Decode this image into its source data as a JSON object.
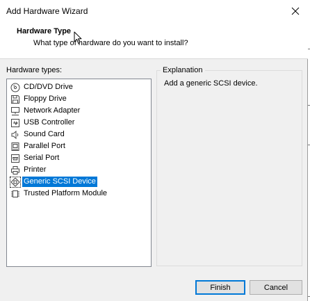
{
  "window": {
    "title": "Add Hardware Wizard"
  },
  "header": {
    "title": "Hardware Type",
    "subtitle": "What type of hardware do you want to install?"
  },
  "hardware_list": {
    "label": "Hardware types:",
    "selected_index": 7,
    "items": [
      {
        "label": "CD/DVD Drive",
        "icon": "cd-dvd-icon"
      },
      {
        "label": "Floppy Drive",
        "icon": "floppy-drive-icon"
      },
      {
        "label": "Network Adapter",
        "icon": "network-adapter-icon"
      },
      {
        "label": "USB Controller",
        "icon": "usb-controller-icon"
      },
      {
        "label": "Sound Card",
        "icon": "sound-card-icon"
      },
      {
        "label": "Parallel Port",
        "icon": "parallel-port-icon"
      },
      {
        "label": "Serial Port",
        "icon": "serial-port-icon"
      },
      {
        "label": "Printer",
        "icon": "printer-icon"
      },
      {
        "label": "Generic SCSI Device",
        "icon": "scsi-device-icon"
      },
      {
        "label": "Trusted Platform Module",
        "icon": "tpm-chip-icon"
      }
    ]
  },
  "explanation": {
    "label": "Explanation",
    "text": "Add a generic SCSI device."
  },
  "buttons": {
    "finish": "Finish",
    "cancel": "Cancel"
  }
}
